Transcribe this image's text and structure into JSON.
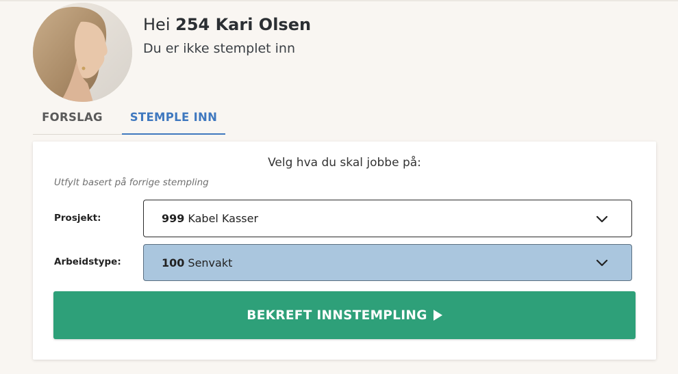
{
  "user": {
    "greeting_prefix": "Hei",
    "name": "254 Kari Olsen",
    "status": "Du er ikke stemplet inn"
  },
  "tabs": [
    {
      "label": "FORSLAG",
      "active": false
    },
    {
      "label": "STEMPLE INN",
      "active": true
    }
  ],
  "form": {
    "heading": "Velg hva du skal jobbe på:",
    "hint": "Utfylt basert på forrige stempling",
    "project": {
      "label": "Prosjekt:",
      "code": "999",
      "name": "Kabel Kasser"
    },
    "work_type": {
      "label": "Arbeidstype:",
      "code": "100",
      "name": "Senvakt"
    },
    "confirm_label": "BEKREFT INNSTEMPLING"
  },
  "colors": {
    "background": "#f9f6f2",
    "active_tab": "#3f78bf",
    "confirm_button": "#2ea079",
    "highlight_select": "#aac6de"
  },
  "icons": {
    "avatar": "user-avatar-photo",
    "select_chevron": "chevron-down-icon",
    "confirm": "play-icon"
  }
}
